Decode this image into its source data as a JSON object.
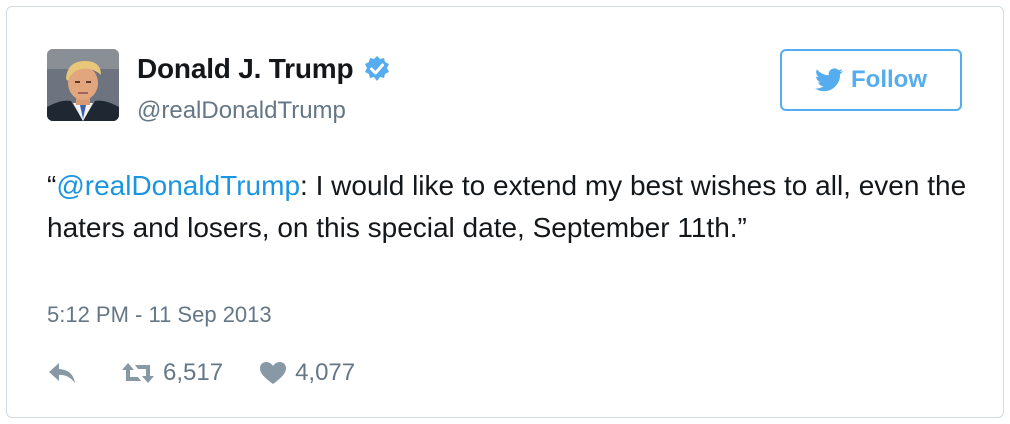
{
  "tweet": {
    "author": {
      "name": "Donald J. Trump",
      "handle": "@realDonaldTrump",
      "verified": true
    },
    "follow_label": "Follow",
    "text": {
      "open_quote": "“",
      "mention": "@realDonaldTrump",
      "body": ": I would like to extend my best wishes to all, even the haters and losers, on this special date, September 11th.”"
    },
    "timestamp": "5:12 PM - 11 Sep 2013",
    "retweets": "6,517",
    "likes": "4,077"
  },
  "colors": {
    "accent": "#55acee",
    "link": "#1b95e0",
    "muted": "#657786",
    "text": "#14171a",
    "border": "#d3dbe2"
  },
  "icons": {
    "avatar": "profile-photo",
    "verified": "verified-badge-icon",
    "follow": "twitter-bird-icon",
    "reply": "reply-icon",
    "retweet": "retweet-icon",
    "like": "heart-icon"
  }
}
